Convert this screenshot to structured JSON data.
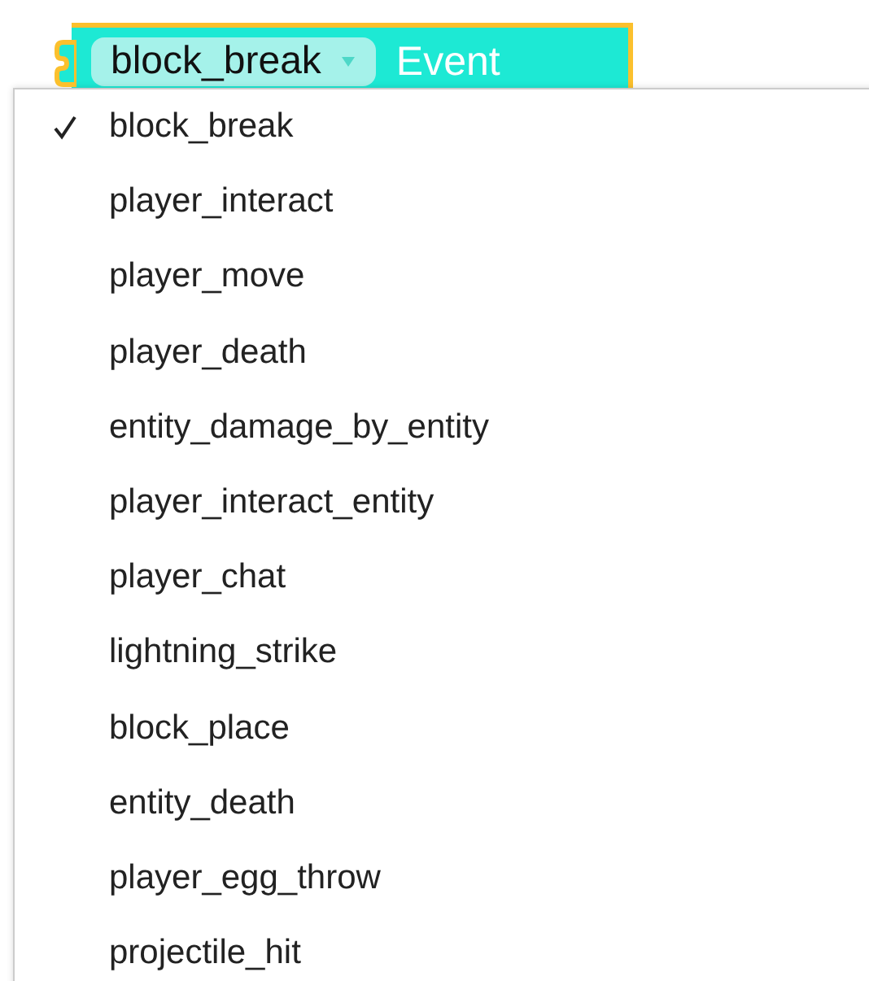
{
  "block": {
    "field": {
      "value": "block_break"
    },
    "label": "Event"
  },
  "menu": {
    "items": [
      {
        "label": "block_break",
        "selected": true
      },
      {
        "label": "player_interact",
        "selected": false
      },
      {
        "label": "player_move",
        "selected": false
      },
      {
        "label": "player_death",
        "selected": false
      },
      {
        "label": "entity_damage_by_entity",
        "selected": false
      },
      {
        "label": "player_interact_entity",
        "selected": false
      },
      {
        "label": "player_chat",
        "selected": false
      },
      {
        "label": "lightning_strike",
        "selected": false
      },
      {
        "label": "block_place",
        "selected": false
      },
      {
        "label": "entity_death",
        "selected": false
      },
      {
        "label": "player_egg_throw",
        "selected": false
      },
      {
        "label": "projectile_hit",
        "selected": false
      }
    ]
  }
}
